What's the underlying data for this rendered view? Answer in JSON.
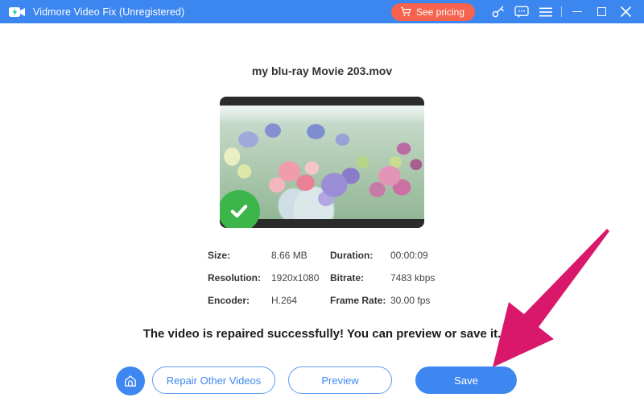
{
  "titlebar": {
    "app_title": "Vidmore Video Fix (Unregistered)",
    "pricing_label": "See pricing"
  },
  "content": {
    "filename": "my blu-ray Movie 203.mov",
    "info_rows": [
      {
        "c0": "Size:",
        "c1": "8.66 MB",
        "c2": "Duration:",
        "c3": "00:00:09"
      },
      {
        "c0": "Resolution:",
        "c1": "1920x1080",
        "c2": "Bitrate:",
        "c3": "7483 kbps"
      },
      {
        "c0": "Encoder:",
        "c1": "H.264",
        "c2": "Frame Rate:",
        "c3": "30.00 fps"
      }
    ],
    "success_message": "The video is repaired successfully! You can preview or save it."
  },
  "actions": {
    "repair_other": "Repair Other Videos",
    "preview": "Preview",
    "save": "Save"
  },
  "colors": {
    "titlebar_blue": "#3c86f0",
    "accent_blue": "#3e87f0",
    "pricing_orange": "#f5624d",
    "check_green": "#3cb54a",
    "arrow_pink": "#d9186b"
  }
}
